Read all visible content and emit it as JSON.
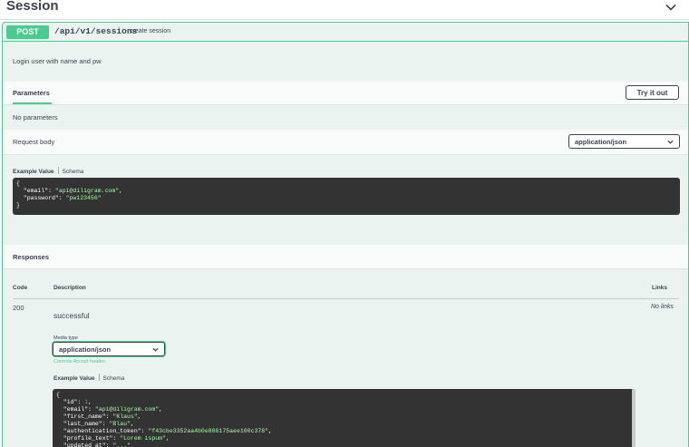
{
  "tag": {
    "title": "Session"
  },
  "operation": {
    "method": "POST",
    "path": "/api/v1/sessions",
    "summary": "create session",
    "description": "Login user with name and pw"
  },
  "parameters": {
    "tab_label": "Parameters",
    "try_button": "Try it out",
    "empty_text": "No parameters"
  },
  "request_body": {
    "label": "Request body",
    "content_type": "application/json",
    "tabs": [
      "Example Value",
      "Schema"
    ],
    "example_lines": [
      "{",
      "  \"email\": \"api@diligram.com\",",
      "  \"password\": \"pw123456\"",
      "}"
    ]
  },
  "responses": {
    "title": "Responses",
    "columns": {
      "code": "Code",
      "description": "Description",
      "links": "Links"
    },
    "rows": [
      {
        "code": "200",
        "description": "successful",
        "links": "No links",
        "media_type_label": "Media type",
        "media_type": "application/json",
        "controls_note": "Controls Accept header.",
        "tabs": [
          "Example Value",
          "Schema"
        ],
        "example_lines": [
          "{",
          "  \"id\": 1,",
          "  \"email\": \"api@diligram.com\",",
          "  \"first_name\": \"Klaus\",",
          "  \"last_name\": \"Blau\",",
          "  \"authentication_token\": \"f43cbe3352aa4b0e806175aee100c378\",",
          "  \"profile_text\": \"Lorem ispum\",",
          "  \"updated_at\": \"...\""
        ]
      }
    ]
  },
  "colors": {
    "post_green": "#49cc90",
    "post_bg": "#ebf3f0",
    "code_bg": "#333333",
    "text": "#3b4151"
  },
  "icons": {
    "collapse": "chevron-down-icon",
    "select": "chevron-down-icon"
  }
}
